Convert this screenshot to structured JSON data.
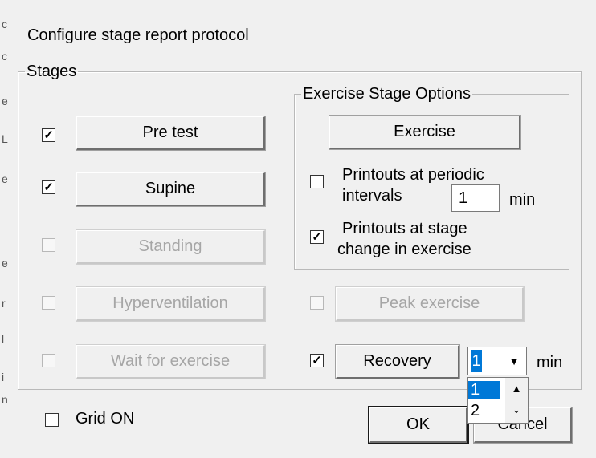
{
  "dialog": {
    "title": "Configure stage report protocol",
    "stages_legend": "Stages",
    "exercise_legend": "Exercise Stage Options",
    "left_strip_chars": [
      "c",
      "c",
      "e",
      "L",
      "e",
      "e",
      "r",
      "l",
      "i",
      "n"
    ]
  },
  "stages": [
    {
      "label": "Pre test",
      "checked": true,
      "enabled": true,
      "check_mark": "✓"
    },
    {
      "label": "Supine",
      "checked": true,
      "enabled": true,
      "check_mark": "✓"
    },
    {
      "label": "Standing",
      "checked": false,
      "enabled": false
    },
    {
      "label": "Hyperventilation",
      "checked": false,
      "enabled": false
    },
    {
      "label": "Wait for exercise",
      "checked": false,
      "enabled": false
    }
  ],
  "exercise": {
    "button_label": "Exercise",
    "periodic_label": "Printouts at periodic intervals",
    "periodic_line1": "Printouts at periodic",
    "periodic_line2": "intervals",
    "periodic_checked": false,
    "interval_value": "1",
    "interval_unit": "min",
    "stage_change_line1": "Printouts at stage",
    "stage_change_line2": "change in exercise",
    "stage_change_checked": true,
    "check_mark": "✓"
  },
  "peak": {
    "label": "Peak exercise",
    "checked": false,
    "enabled": false
  },
  "recovery": {
    "label": "Recovery",
    "checked": true,
    "check_mark": "✓",
    "selected_value": "1",
    "unit": "min",
    "options": [
      "1",
      "2"
    ]
  },
  "grid": {
    "label": "Grid ON",
    "checked": false
  },
  "buttons": {
    "ok": "OK",
    "cancel": "Cancel"
  },
  "icons": {
    "dropdown": "▼",
    "up": "▲",
    "down": "⌄"
  }
}
